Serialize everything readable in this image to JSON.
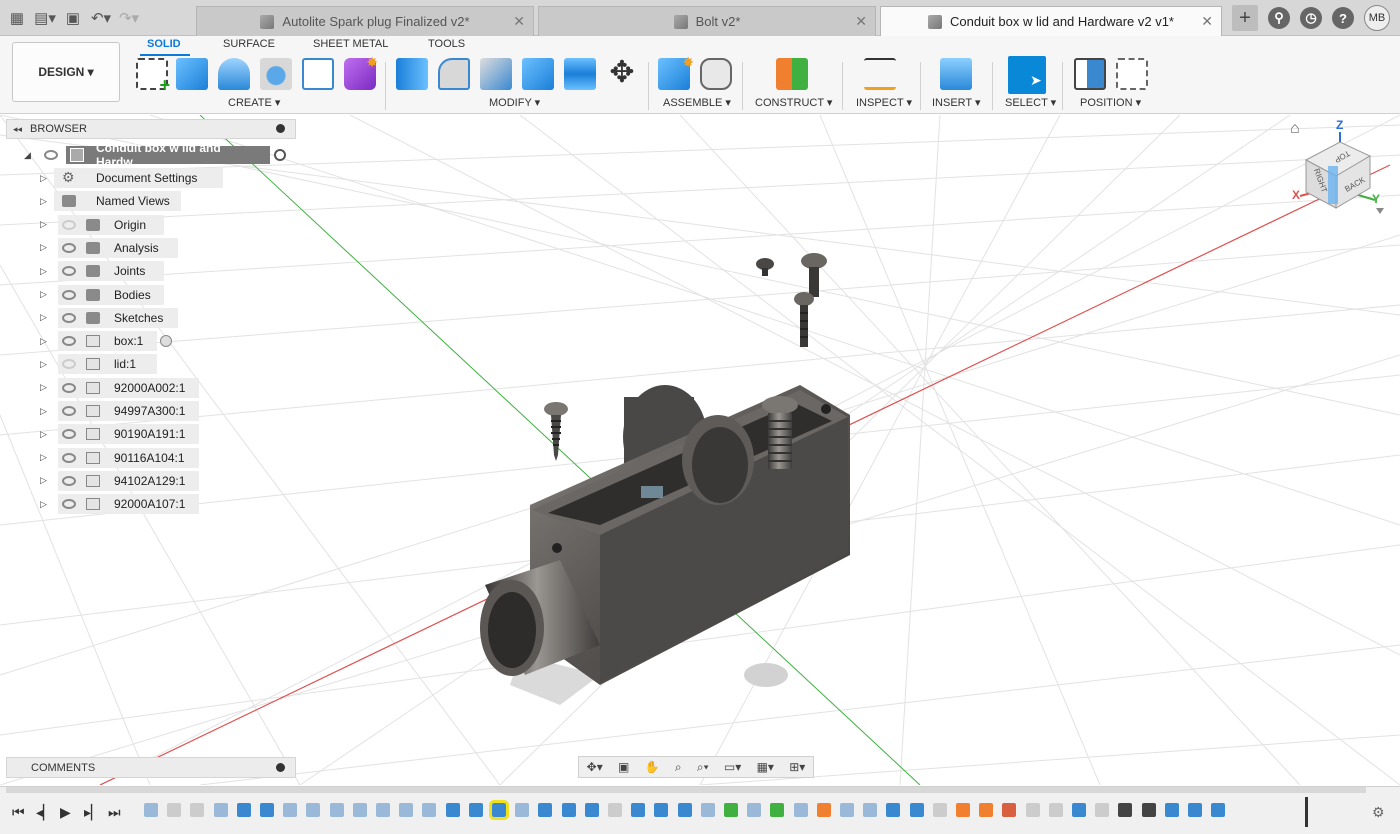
{
  "app": {
    "tabs": [
      {
        "title": "Autolite Spark plug Finalized v2*",
        "active": false
      },
      {
        "title": "Bolt v2*",
        "active": false
      },
      {
        "title": "Conduit box w lid and Hardware v2 v1*",
        "active": true
      }
    ],
    "user_initials": "MB"
  },
  "toolbar": {
    "design_label": "DESIGN ▾",
    "workspace_tabs": [
      "SOLID",
      "SURFACE",
      "SHEET METAL",
      "TOOLS"
    ],
    "active_workspace": "SOLID",
    "groups": [
      "CREATE ▾",
      "MODIFY ▾",
      "ASSEMBLE ▾",
      "CONSTRUCT ▾",
      "INSPECT ▾",
      "INSERT ▾",
      "SELECT ▾",
      "POSITION ▾"
    ]
  },
  "browser": {
    "title": "BROWSER",
    "root": "Conduit box w lid and Hardw...",
    "items": [
      {
        "label": "Document Settings",
        "icon": "gear-icon",
        "eye": "none"
      },
      {
        "label": "Named Views",
        "icon": "folder-icon",
        "eye": "none"
      },
      {
        "label": "Origin",
        "icon": "folder-icon",
        "eye": "off"
      },
      {
        "label": "Analysis",
        "icon": "folder-icon",
        "eye": "on"
      },
      {
        "label": "Joints",
        "icon": "folder-icon",
        "eye": "on"
      },
      {
        "label": "Bodies",
        "icon": "folder-icon",
        "eye": "on"
      },
      {
        "label": "Sketches",
        "icon": "folder-icon",
        "eye": "on"
      },
      {
        "label": "box:1",
        "icon": "component-icon",
        "eye": "on"
      },
      {
        "label": "lid:1",
        "icon": "component-icon",
        "eye": "off"
      },
      {
        "label": "92000A002:1",
        "icon": "component-icon",
        "eye": "on"
      },
      {
        "label": "94997A300:1",
        "icon": "component-icon",
        "eye": "on"
      },
      {
        "label": "90190A191:1",
        "icon": "component-icon",
        "eye": "on"
      },
      {
        "label": "90116A104:1",
        "icon": "component-icon",
        "eye": "on"
      },
      {
        "label": "94102A129:1",
        "icon": "component-icon",
        "eye": "on"
      },
      {
        "label": "92000A107:1",
        "icon": "component-icon",
        "eye": "on"
      }
    ]
  },
  "comments": {
    "label": "COMMENTS"
  },
  "viewcube": {
    "top": "TOP",
    "right": "RIGHT",
    "back": "BACK",
    "x": "X",
    "y": "Y",
    "z": "Z"
  },
  "colors": {
    "accent": "#0a7bd8",
    "x_axis": "#e05050",
    "y_axis": "#40b040",
    "model": "#565350"
  }
}
